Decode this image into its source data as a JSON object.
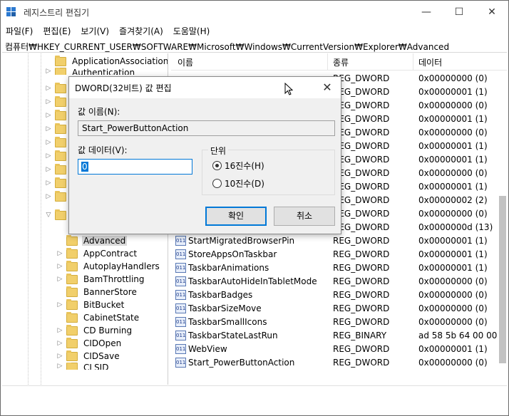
{
  "window": {
    "title": "레지스트리 편집기",
    "minimize_glyph": "—",
    "maximize_glyph": "☐",
    "close_glyph": "✕"
  },
  "menu": [
    "파일(F)",
    "편집(E)",
    "보기(V)",
    "즐겨찾기(A)",
    "도움말(H)"
  ],
  "address": "컴퓨터₩HKEY_CURRENT_USER₩SOFTWARE₩Microsoft₩Windows₩CurrentVersion₩Explorer₩Advanced",
  "tree": {
    "top_items": [
      "ApplicationAssociation",
      "Authentication"
    ],
    "selected": "Advanced",
    "items": [
      "AppContract",
      "AutoplayHandlers",
      "BamThrottling",
      "BannerStore",
      "BitBucket",
      "CabinetState",
      "CD Burning",
      "CIDOpen",
      "CIDSave",
      "CLSID"
    ]
  },
  "list": {
    "headers": {
      "name": "이름",
      "type": "종류",
      "data": "데이터"
    },
    "hidden_rows": [
      {
        "type": "REG_DWORD",
        "data": "0x00000000 (0)"
      },
      {
        "type": "REG_DWORD",
        "data": "0x00000001 (1)"
      },
      {
        "type": "REG_DWORD",
        "data": "0x00000000 (0)"
      },
      {
        "type": "REG_DWORD",
        "data": "0x00000001 (1)"
      },
      {
        "type": "REG_DWORD",
        "data": "0x00000000 (0)"
      },
      {
        "type": "REG_DWORD",
        "data": "0x00000001 (1)"
      },
      {
        "type": "REG_DWORD",
        "data": "0x00000001 (1)"
      },
      {
        "type": "REG_DWORD",
        "data": "0x00000000 (0)"
      },
      {
        "type": "REG_DWORD",
        "data": "0x00000001 (1)"
      },
      {
        "type": "REG_DWORD",
        "data": "0x00000002 (2)"
      },
      {
        "type": "REG_DWORD",
        "data": "0x00000000 (0)"
      },
      {
        "type": "REG_DWORD",
        "data": "0x0000000d (13)"
      }
    ],
    "rows": [
      {
        "name": "StartMigratedBrowserPin",
        "type": "REG_DWORD",
        "data": "0x00000001 (1)"
      },
      {
        "name": "StoreAppsOnTaskbar",
        "type": "REG_DWORD",
        "data": "0x00000001 (1)"
      },
      {
        "name": "TaskbarAnimations",
        "type": "REG_DWORD",
        "data": "0x00000001 (1)"
      },
      {
        "name": "TaskbarAutoHideInTabletMode",
        "type": "REG_DWORD",
        "data": "0x00000000 (0)"
      },
      {
        "name": "TaskbarBadges",
        "type": "REG_DWORD",
        "data": "0x00000000 (0)"
      },
      {
        "name": "TaskbarSizeMove",
        "type": "REG_DWORD",
        "data": "0x00000000 (0)"
      },
      {
        "name": "TaskbarSmallIcons",
        "type": "REG_DWORD",
        "data": "0x00000000 (0)"
      },
      {
        "name": "TaskbarStateLastRun",
        "type": "REG_BINARY",
        "data": "ad 58 5b 64 00 00 0"
      },
      {
        "name": "WebView",
        "type": "REG_DWORD",
        "data": "0x00000001 (1)"
      },
      {
        "name": "Start_PowerButtonAction",
        "type": "REG_DWORD",
        "data": "0x00000000 (0)"
      }
    ]
  },
  "dialog": {
    "title": "DWORD(32비트) 값 편집",
    "name_label": "값 이름(N):",
    "name_value": "Start_PowerButtonAction",
    "data_label": "값 데이터(V):",
    "data_value": "0",
    "base_label": "단위",
    "hex_label": "16진수(H)",
    "dec_label": "10진수(D)",
    "ok_label": "확인",
    "cancel_label": "취소",
    "close_glyph": "✕"
  }
}
